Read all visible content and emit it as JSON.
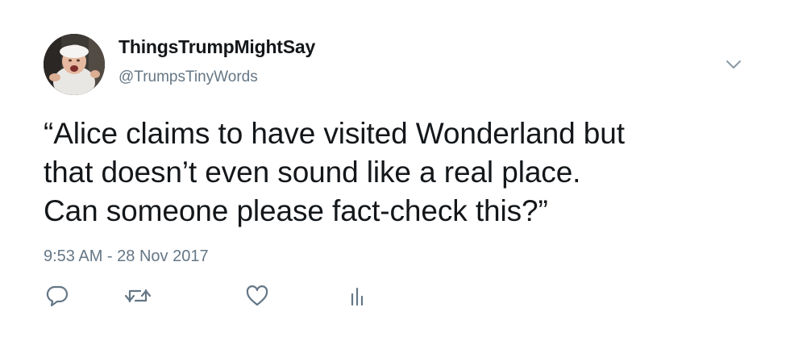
{
  "author": {
    "display_name": "ThingsTrumpMightSay",
    "handle": "@TrumpsTinyWords"
  },
  "tweet": {
    "text": "“Alice claims to have visited Wonderland but\nthat doesn’t even sound like a real place.\nCan someone please fact-check this?”",
    "timestamp": "9:53 AM - 28 Nov 2017"
  },
  "icons": {
    "more": "chevron-down-icon",
    "reply": "reply-icon",
    "retweet": "retweet-icon",
    "like": "heart-icon",
    "analytics": "analytics-icon"
  },
  "colors": {
    "text": "#14171a",
    "secondary": "#657786",
    "icon": "#657786"
  }
}
